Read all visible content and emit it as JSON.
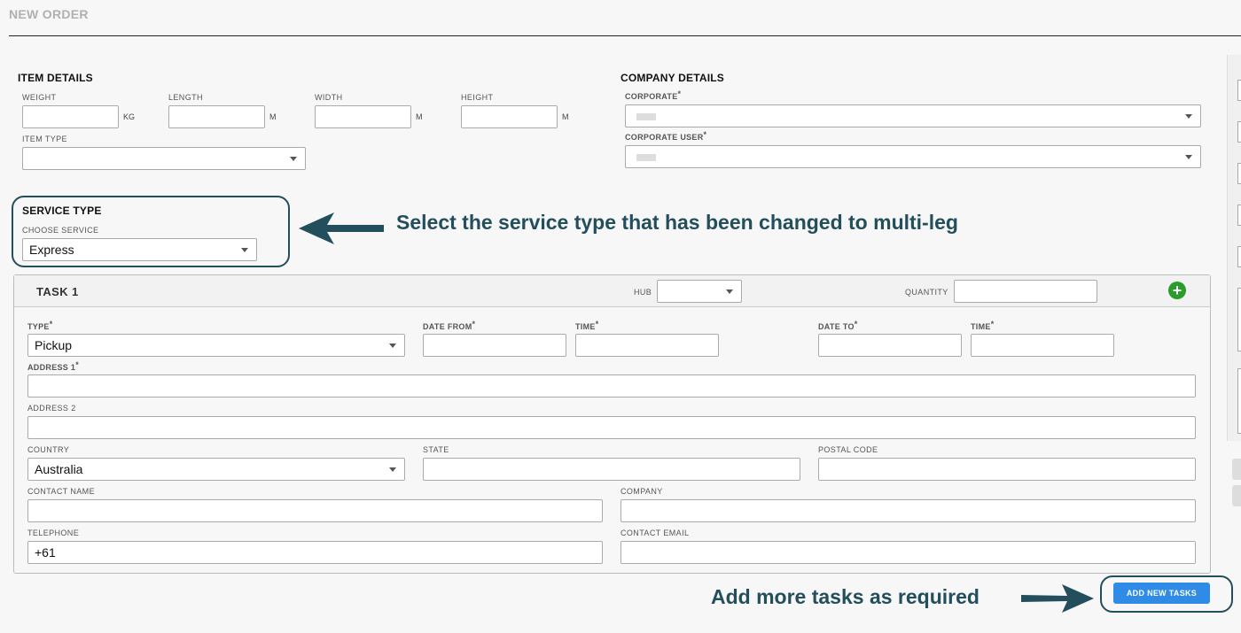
{
  "page": {
    "title": "NEW ORDER"
  },
  "item_details": {
    "heading": "ITEM DETAILS",
    "weight_label": "WEIGHT",
    "weight_unit": "KG",
    "length_label": "LENGTH",
    "length_unit": "M",
    "width_label": "WIDTH",
    "width_unit": "M",
    "height_label": "HEIGHT",
    "height_unit": "M",
    "item_type_label": "ITEM TYPE"
  },
  "company_details": {
    "heading": "COMPANY DETAILS",
    "corporate_label": "CORPORATE",
    "corporate_user_label": "CORPORATE USER",
    "required_mark": "*"
  },
  "service_type": {
    "heading": "SERVICE TYPE",
    "choose_label": "CHOOSE SERVICE",
    "selected": "Express"
  },
  "annotations": {
    "service_note": "Select the service type that has been changed to multi-leg",
    "tasks_note": "Add more tasks as required"
  },
  "task": {
    "title": "TASK 1",
    "hub_label": "HUB",
    "quantity_label": "QUANTITY",
    "add_icon": "plus-circle-icon",
    "type_label": "TYPE",
    "type_value": "Pickup",
    "date_from_label": "DATE FROM",
    "time_label": "TIME",
    "date_to_label": "DATE TO",
    "address1_label": "ADDRESS 1",
    "address2_label": "ADDRESS 2",
    "country_label": "COUNTRY",
    "country_value": "Australia",
    "state_label": "STATE",
    "postal_label": "POSTAL CODE",
    "contact_name_label": "CONTACT NAME",
    "company_label": "COMPANY",
    "telephone_label": "TELEPHONE",
    "telephone_value": "+61",
    "contact_email_label": "CONTACT EMAIL",
    "required_mark": "*"
  },
  "actions": {
    "add_new_tasks": "ADD NEW TASKS"
  },
  "colors": {
    "accent": "#2f8be6",
    "annotation": "#234e5c",
    "add_icon": "#2a9d2a"
  }
}
